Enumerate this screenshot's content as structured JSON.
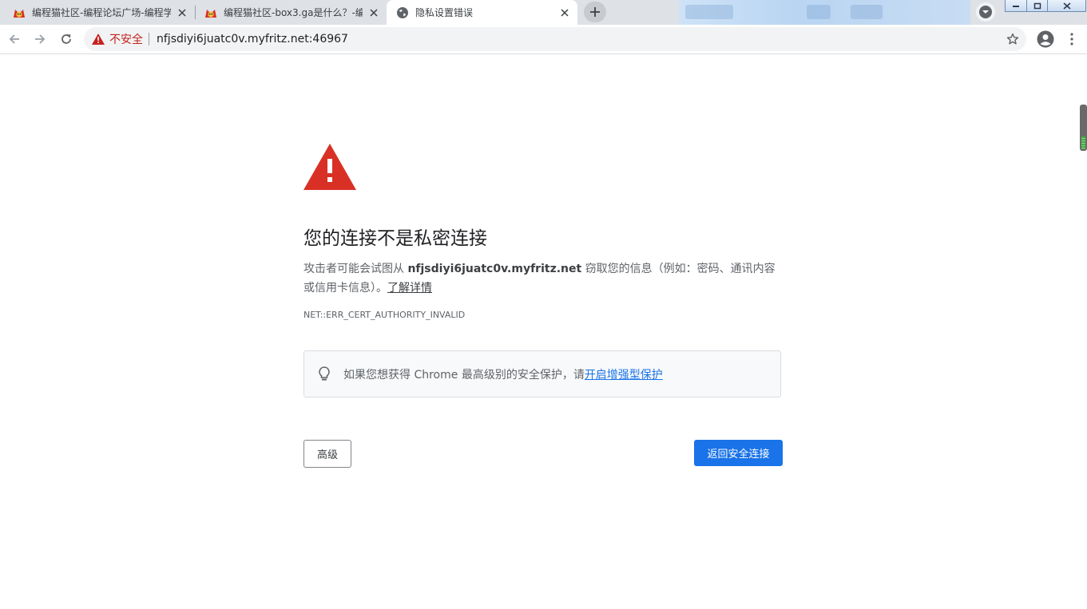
{
  "tabs": [
    {
      "title": "编程猫社区-编程论坛广场-编程学",
      "active": false,
      "favicon": "coding-cat-icon"
    },
    {
      "title": "编程猫社区-box3.ga是什么？-编",
      "active": false,
      "favicon": "coding-cat-icon"
    },
    {
      "title": "隐私设置错误",
      "active": true,
      "favicon": "globe-icon"
    }
  ],
  "omnibox": {
    "security_label": "不安全",
    "url": "nfjsdiyi6juatc0v.myfritz.net:46967"
  },
  "interstitial": {
    "heading": "您的连接不是私密连接",
    "desc_prefix": "攻击者可能会试图从 ",
    "desc_host": "nfjsdiyi6juatc0v.myfritz.net",
    "desc_suffix": " 窃取您的信息（例如：密码、通讯内容或信用卡信息）。",
    "learn_more": "了解详情",
    "error_code": "NET::ERR_CERT_AUTHORITY_INVALID",
    "tip_text": "如果您想获得 Chrome 最高级别的安全保护，请",
    "tip_link": "开启增强型保护",
    "advanced_button": "高级",
    "back_button": "返回安全连接"
  },
  "colors": {
    "warning_red": "#d93025",
    "insecure_text": "#c5221f",
    "primary_blue": "#1a73e8",
    "tabstrip_bg": "#dee1e6"
  }
}
